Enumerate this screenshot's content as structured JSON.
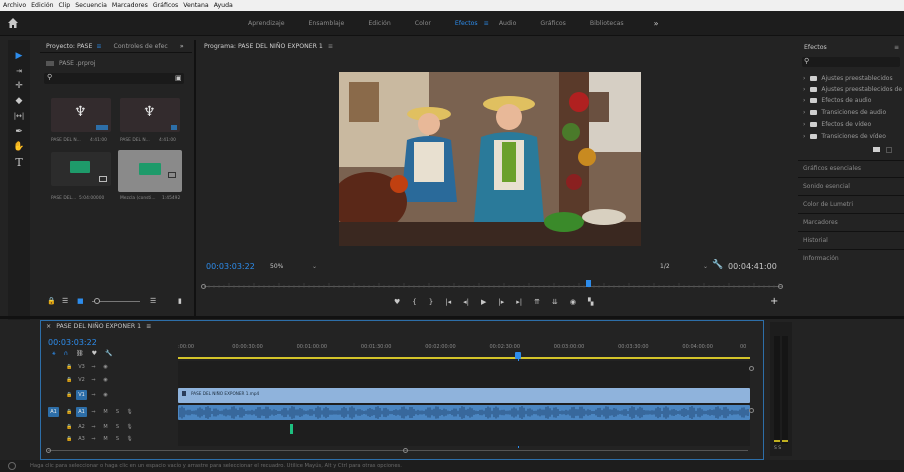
{
  "menubar": {
    "items": [
      "Archivo",
      "Edición",
      "Clip",
      "Secuencia",
      "Marcadores",
      "Gráficos",
      "Ventana",
      "Ayuda"
    ]
  },
  "workspaces": {
    "tabs": [
      "Aprendizaje",
      "Ensamblaje",
      "Edición",
      "Color",
      "Efectos",
      "Audio",
      "Gráficos",
      "Bibliotecas"
    ],
    "active": "Efectos",
    "more": "»"
  },
  "project": {
    "tab_project": "Proyecto: PASE",
    "tab_menu": "≡",
    "tab_controls": "Controles de efec",
    "more": "»",
    "file": "PASE .prproj",
    "items": [
      {
        "name": "PASE DEL N...",
        "duration": "4:41:00"
      },
      {
        "name": "PASE DEL N...",
        "duration": "4:41:00"
      },
      {
        "name": "PASE DEL...",
        "duration": "5:04:00000"
      },
      {
        "name": "Mezcla (consti...",
        "duration": "1:45492"
      }
    ]
  },
  "program": {
    "title": "Programa: PASE DEL NIÑO EXPONER 1",
    "menu": "≡",
    "timecode": "00:03:03:22",
    "zoom": "50%",
    "quality": "1/2",
    "duration": "00:04:41:00",
    "playhead_fraction": 0.665
  },
  "timeline": {
    "seq_name": "PASE DEL NIÑO EXPONER 1",
    "menu": "≡",
    "timecode": "00:03:03:22",
    "ruler": [
      ":00:00",
      "00:00:30:00",
      "00:01:00:00",
      "00:01:30:00",
      "00:02:00:00",
      "00:02:30:00",
      "00:03:00:00",
      "00:03:30:00",
      "00:04:00:00",
      "00"
    ],
    "tracks": [
      {
        "name": "V3",
        "type": "v"
      },
      {
        "name": "V2",
        "type": "v"
      },
      {
        "name": "V1",
        "type": "v",
        "target": true
      },
      {
        "name": "A1",
        "type": "a",
        "target": true,
        "src": "A1"
      },
      {
        "name": "A2",
        "type": "a"
      },
      {
        "name": "A3",
        "type": "a"
      }
    ],
    "clip_label": "PASE DEL NIÑO EXPONER 1.mp4",
    "meter_label": "S S"
  },
  "effects": {
    "title": "Efectos",
    "menu": "≡",
    "tree": [
      "Ajustes preestablecidos",
      "Ajustes preestablecidos de",
      "Efectos de audio",
      "Transiciones de audio",
      "Efectos de vídeo",
      "Transiciones de vídeo"
    ],
    "panels": [
      "Gráficos esenciales",
      "Sonido esencial",
      "Color de Lumetri",
      "Marcadores",
      "Historial",
      "Información"
    ]
  },
  "status": {
    "text": "Haga clic para seleccionar o haga clic en un espacio vacío y arrastre para seleccionar el recuadro. Utilice Mayús, Alt y Ctrl para otras opciones."
  },
  "colors": {
    "accent": "#2d8ceb",
    "audio_clip": "#4b86c2",
    "video_clip": "#8fb3dc",
    "panel": "#232323"
  },
  "icons": [
    "home-icon",
    "selection-tool-icon",
    "track-select-icon",
    "ripple-edit-icon",
    "razor-icon",
    "slip-icon",
    "pen-icon",
    "hand-icon",
    "type-icon",
    "marker-icon",
    "play-icon",
    "step-back-icon",
    "step-forward-icon",
    "lift-icon",
    "extract-icon",
    "export-frame-icon",
    "search-icon",
    "new-bin-icon",
    "wrench-icon",
    "add-button-icon"
  ]
}
